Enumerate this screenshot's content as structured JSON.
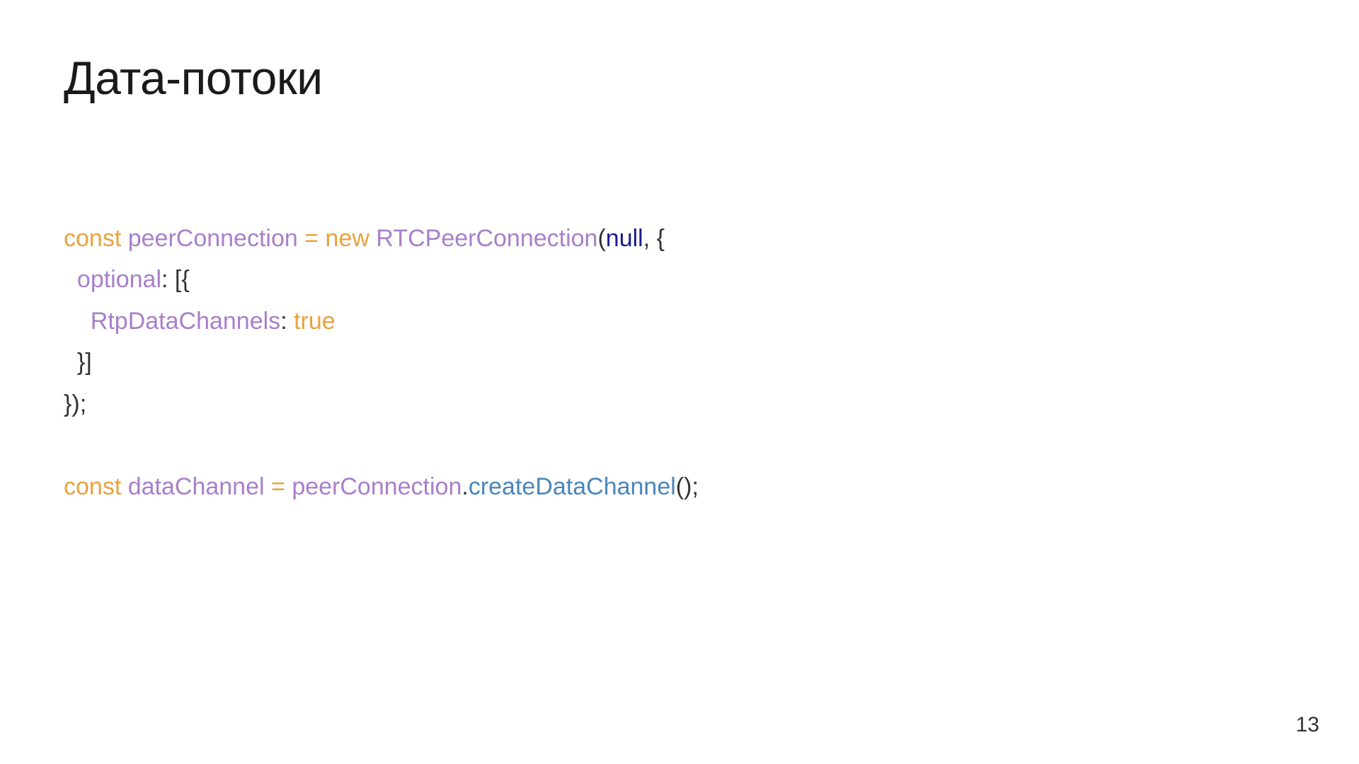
{
  "title": "Дата-потоки",
  "page_number": "13",
  "code": {
    "line1": {
      "const": "const",
      "var": "peerConnection",
      "eq": "=",
      "new": "new",
      "class": "RTCPeerConnection",
      "open_paren": "(",
      "null": "null",
      "comma": ",",
      "open_brace": "{"
    },
    "line2": {
      "indent": "  ",
      "property": "optional",
      "colon": ":",
      "open_bracket": "[",
      "open_brace": "{"
    },
    "line3": {
      "indent": "    ",
      "property": "RtpDataChannels",
      "colon": ":",
      "true": "true"
    },
    "line4": {
      "indent": "  ",
      "close_brace": "}",
      "close_bracket": "]"
    },
    "line5": {
      "close_brace": "}",
      "close_paren": ")",
      "semi": ";"
    },
    "line6_blank": "",
    "line7": {
      "const": "const",
      "var": "dataChannel",
      "eq": "=",
      "object": "peerConnection",
      "dot": ".",
      "method": "createDataChannel",
      "open_paren": "(",
      "close_paren": ")",
      "semi": ";"
    }
  }
}
